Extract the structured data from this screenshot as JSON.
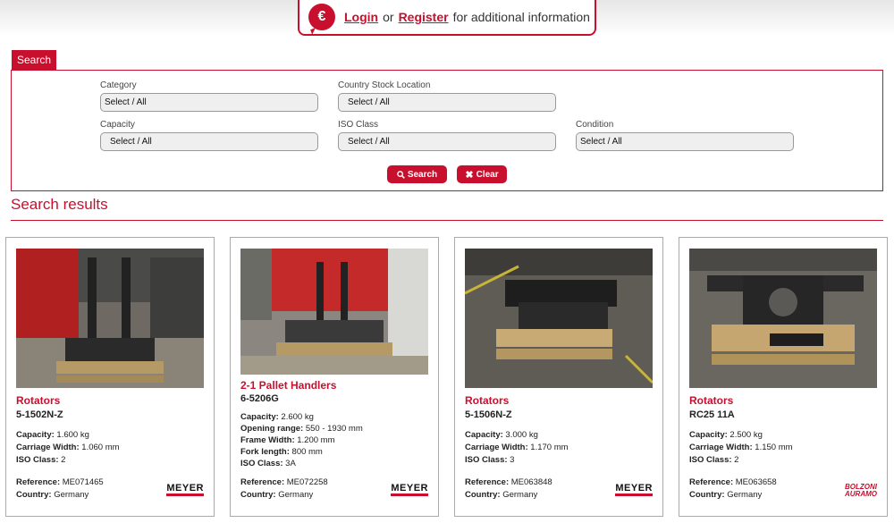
{
  "banner": {
    "login": "Login",
    "or": "or",
    "register": "Register",
    "rest": "for additional information",
    "icon": "euro-icon"
  },
  "search": {
    "tab": "Search",
    "fields": {
      "category": {
        "label": "Category",
        "value": "Select / All"
      },
      "country": {
        "label": "Country Stock Location",
        "value": "Select / All"
      },
      "capacity": {
        "label": "Capacity",
        "value": "Select / All"
      },
      "iso": {
        "label": "ISO Class",
        "value": "Select / All"
      },
      "condition": {
        "label": "Condition",
        "value": "Select / All"
      }
    },
    "search_button": "Search",
    "clear_button": "Clear"
  },
  "results": {
    "title": "Search results",
    "items": [
      {
        "category": "Rotators",
        "model": "5-1502N-Z",
        "specs": [
          {
            "label": "Capacity:",
            "value": "1.600 kg"
          },
          {
            "label": "Carriage Width:",
            "value": "1.060 mm"
          },
          {
            "label": "ISO Class:",
            "value": "2"
          }
        ],
        "reference_label": "Reference:",
        "reference": "ME071465",
        "country_label": "Country:",
        "country": "Germany",
        "brand": "MEYER"
      },
      {
        "category": "2-1 Pallet Handlers",
        "model": "6-5206G",
        "specs": [
          {
            "label": "Capacity:",
            "value": "2.600 kg"
          },
          {
            "label": "Opening range:",
            "value": "550 - 1930 mm"
          },
          {
            "label": "Frame Width:",
            "value": "1.200 mm"
          },
          {
            "label": "Fork length:",
            "value": "800 mm"
          },
          {
            "label": "ISO Class:",
            "value": "3A"
          }
        ],
        "reference_label": "Reference:",
        "reference": "ME072258",
        "country_label": "Country:",
        "country": "Germany",
        "brand": "MEYER"
      },
      {
        "category": "Rotators",
        "model": "5-1506N-Z",
        "specs": [
          {
            "label": "Capacity:",
            "value": "3.000 kg"
          },
          {
            "label": "Carriage Width:",
            "value": "1.170 mm"
          },
          {
            "label": "ISO Class:",
            "value": "3"
          }
        ],
        "reference_label": "Reference:",
        "reference": "ME063848",
        "country_label": "Country:",
        "country": "Germany",
        "brand": "MEYER"
      },
      {
        "category": "Rotators",
        "model": "RC25 11A",
        "specs": [
          {
            "label": "Capacity:",
            "value": "2.500 kg"
          },
          {
            "label": "Carriage Width:",
            "value": "1.150 mm"
          },
          {
            "label": "ISO Class:",
            "value": "2"
          }
        ],
        "reference_label": "Reference:",
        "reference": "ME063658",
        "country_label": "Country:",
        "country": "Germany",
        "brand": "BOLZONI AURAMO"
      }
    ]
  },
  "colors": {
    "accent": "#c8102e"
  }
}
